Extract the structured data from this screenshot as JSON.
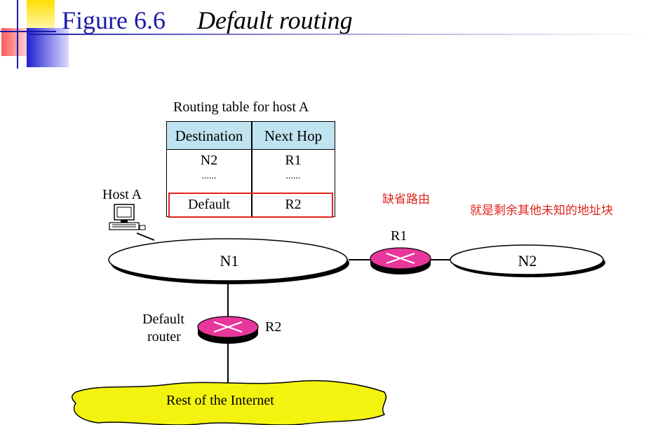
{
  "header": {
    "figure_number": "Figure 6.6",
    "caption": "Default routing"
  },
  "routing_table": {
    "caption": "Routing table for host A",
    "columns": [
      "Destination",
      "Next Hop"
    ],
    "rows": [
      [
        "N2",
        "R1"
      ],
      [
        "......",
        "......"
      ],
      [
        "Default",
        "R2"
      ]
    ]
  },
  "network": {
    "host_label": "Host A",
    "n1_label": "N1",
    "n2_label": "N2",
    "r1_label": "R1",
    "r2_label": "R2",
    "default_router_line1": "Default",
    "default_router_line2": "router",
    "internet_label": "Rest of the Internet"
  },
  "annotations": {
    "default_route": "缺省路由",
    "default_meaning": "就是剩余其他未知的地址块"
  },
  "colors": {
    "title_blue": "#1a1aa8",
    "table_header": "#bfe3f0",
    "router_pink": "#e8379a",
    "internet_yellow": "#f3f30f",
    "annotation_red": "#e0261c"
  }
}
